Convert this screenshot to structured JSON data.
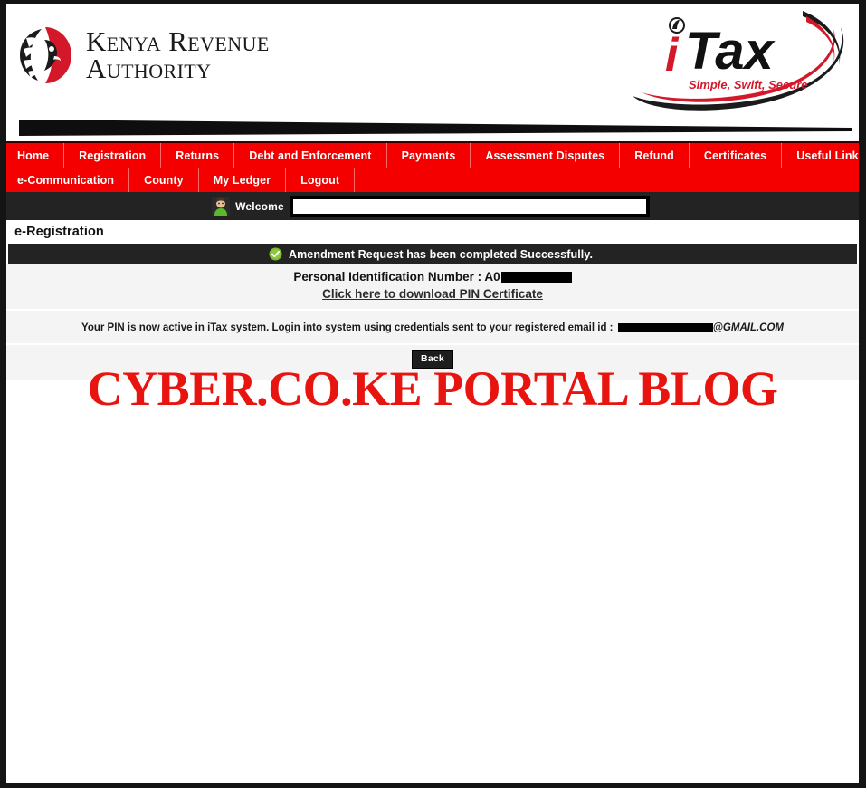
{
  "header": {
    "kra_logo": {
      "icon": "kra-lion-icon",
      "line1": "Kenya Revenue",
      "line2": "Authority"
    },
    "itax_logo": {
      "icon": "itax-logo-icon",
      "i": "i",
      "tax": "Tax",
      "tagline": "Simple, Swift, Secure"
    }
  },
  "nav": {
    "row1": [
      {
        "label": "Home"
      },
      {
        "label": "Registration"
      },
      {
        "label": "Returns"
      },
      {
        "label": "Debt and Enforcement"
      },
      {
        "label": "Payments"
      },
      {
        "label": "Assessment Disputes"
      },
      {
        "label": "Refund"
      },
      {
        "label": "Certificates"
      },
      {
        "label": "Useful Links"
      }
    ],
    "row2": [
      {
        "label": "e-Communication"
      },
      {
        "label": "County"
      },
      {
        "label": "My Ledger"
      },
      {
        "label": "Logout"
      }
    ]
  },
  "welcome": {
    "avatar_icon": "user-avatar-icon",
    "label": "Welcome",
    "username_value": ""
  },
  "page": {
    "title": "e-Registration"
  },
  "success": {
    "icon": "green-check-icon",
    "message": "Amendment Request has been completed Successfully."
  },
  "pin": {
    "label": "Personal Identification Number : A0",
    "redacted_value": "",
    "download_link": "Click here to download PIN Certificate"
  },
  "email_notice": {
    "text": "Your PIN is now active in iTax system. Login into system using credentials sent to your registered email id : ",
    "redacted_value": "",
    "domain": "@GMAIL.COM"
  },
  "actions": {
    "back_label": "Back"
  },
  "watermark": {
    "text": "CYBER.CO.KE PORTAL BLOG"
  },
  "colors": {
    "nav_red": "#f40000",
    "dark_bar": "#232323",
    "watermark_red": "#e8140f",
    "content_bg": "#f5f4f5",
    "brand_red": "#d3182a"
  }
}
